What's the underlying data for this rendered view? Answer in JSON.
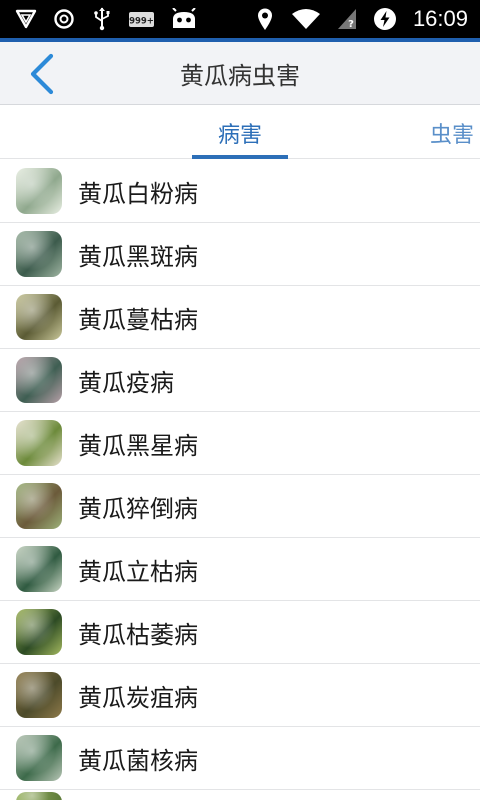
{
  "status_bar": {
    "time": "16:09",
    "battery_badge": "999+",
    "icons": [
      "vpn-shield-icon",
      "ring-icon",
      "usb-icon",
      "battery-badge-icon",
      "android-robot-icon",
      "location-pin-icon",
      "wifi-icon",
      "signal-icon",
      "power-icon"
    ]
  },
  "header": {
    "title": "黄瓜病虫害",
    "back_icon": "chevron-left-icon"
  },
  "tabs": [
    {
      "label": "病害",
      "active": true
    },
    {
      "label": "虫害",
      "active": false
    }
  ],
  "items": [
    {
      "label": "黄瓜白粉病",
      "thumb": [
        "#8fa88d",
        "#e8eee2"
      ]
    },
    {
      "label": "黄瓜黑斑病",
      "thumb": [
        "#3c5b4c",
        "#9fb5a2"
      ]
    },
    {
      "label": "黄瓜蔓枯病",
      "thumb": [
        "#5b5b34",
        "#c9c79a"
      ]
    },
    {
      "label": "黄瓜疫病",
      "thumb": [
        "#3e5e52",
        "#b7a0a8"
      ]
    },
    {
      "label": "黄瓜黑星病",
      "thumb": [
        "#6c8a3a",
        "#e6e1cd"
      ]
    },
    {
      "label": "黄瓜猝倒病",
      "thumb": [
        "#6b5a3a",
        "#9db27a"
      ]
    },
    {
      "label": "黄瓜立枯病",
      "thumb": [
        "#2f5a40",
        "#c7d4c2"
      ]
    },
    {
      "label": "黄瓜枯萎病",
      "thumb": [
        "#2c4a23",
        "#a3b85f"
      ]
    },
    {
      "label": "黄瓜炭疽病",
      "thumb": [
        "#4c4a2a",
        "#8e7a4a"
      ]
    },
    {
      "label": "黄瓜菌核病",
      "thumb": [
        "#3d6a4a",
        "#b8c6b6"
      ]
    }
  ],
  "colors": {
    "accent": "#2d6fb8",
    "status_bar_bg": "#000000",
    "header_bg": "#f2f3f6"
  }
}
